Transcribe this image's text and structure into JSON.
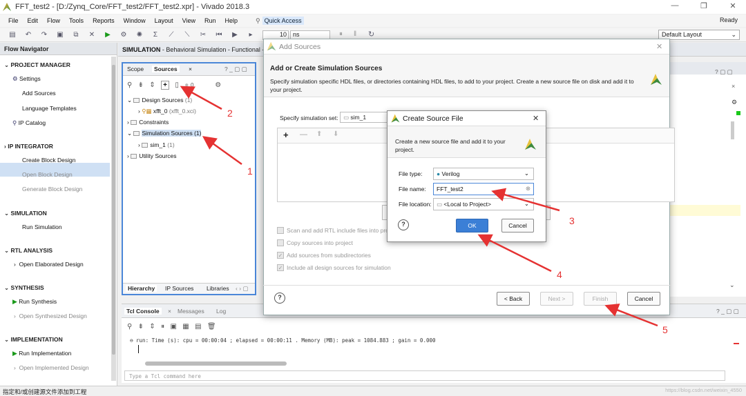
{
  "window": {
    "title": "FFT_test2 - [D:/Zynq_Core/FFT_test2/FFT_test2.xpr] - Vivado 2018.3",
    "status_ready": "Ready"
  },
  "menu": [
    "File",
    "Edit",
    "Flow",
    "Tools",
    "Reports",
    "Window",
    "Layout",
    "View",
    "Run",
    "Help"
  ],
  "quick_access": {
    "label": "Quick Access"
  },
  "toolbar": {
    "time_value": "10",
    "time_unit": "ns",
    "layout": "Default Layout"
  },
  "flow_navigator": {
    "title": "Flow Navigator",
    "sections": [
      {
        "name": "PROJECT MANAGER",
        "items": [
          "Settings",
          "Add Sources",
          "Language Templates",
          "IP Catalog"
        ]
      },
      {
        "name": "IP INTEGRATOR",
        "items": [
          "Create Block Design",
          "Open Block Design",
          "Generate Block Design"
        ]
      },
      {
        "name": "SIMULATION",
        "items": [
          "Run Simulation"
        ]
      },
      {
        "name": "RTL ANALYSIS",
        "items": [
          "Open Elaborated Design"
        ]
      },
      {
        "name": "SYNTHESIS",
        "items": [
          "Run Synthesis",
          "Open Synthesized Design"
        ]
      },
      {
        "name": "IMPLEMENTATION",
        "items": [
          "Run Implementation",
          "Open Implemented Design"
        ]
      }
    ]
  },
  "sim_header": {
    "bold": "SIMULATION",
    "rest": " - Behavioral Simulation - Functional - sim"
  },
  "sources_panel": {
    "tabs": [
      "Scope",
      "Sources"
    ],
    "counter": "0",
    "tree": {
      "design_sources": "Design Sources",
      "design_count": "(1)",
      "xfft": "xfft_0",
      "xfft_file": "(xfft_0.xci)",
      "constraints": "Constraints",
      "simulation_sources": "Simulation Sources (1)",
      "sim_1": "sim_1",
      "sim_1_count": "(1)",
      "utility": "Utility Sources"
    },
    "bottom_tabs": [
      "Hierarchy",
      "IP Sources",
      "Libraries"
    ]
  },
  "tcl": {
    "tabs": [
      "Tcl Console",
      "Messages",
      "Log"
    ],
    "output": "run: Time (s): cpu = 00:00:04 ; elapsed = 00:00:11 . Memory (MB): peak = 1084.883 ; gain = 0.000",
    "placeholder": "Type a Tcl command here"
  },
  "status_bar": "指定和/或创建源文件添加到工程",
  "watermark": "https://blog.csdn.net/weixin_4550",
  "add_sources": {
    "title": "Add Sources",
    "heading": "Add or Create Simulation Sources",
    "description": "Specify simulation specific HDL files, or directories containing HDL files, to add to your project. Create a new source file on disk and add it to your project.",
    "sim_set_label": "Specify simulation set:",
    "sim_set_value": "sim_1",
    "options": [
      {
        "label": "Scan and add RTL include files into proj",
        "checked": false
      },
      {
        "label": "Copy sources into project",
        "checked": false
      },
      {
        "label": "Add sources from subdirectories",
        "checked": true
      },
      {
        "label": "Include all design sources for simulation",
        "checked": true
      }
    ],
    "back": "< Back",
    "next": "Next >",
    "finish": "Finish",
    "cancel": "Cancel"
  },
  "create_source": {
    "title": "Create Source File",
    "description": "Create a new source file and add it to your project.",
    "file_type_label": "File type:",
    "file_type": "Verilog",
    "file_name_label": "File name:",
    "file_name": "FFT_test2",
    "file_location_label": "File location:",
    "file_location": "<Local to Project>",
    "ok": "OK",
    "cancel": "Cancel"
  },
  "annotations": [
    "1",
    "2",
    "3",
    "4",
    "5"
  ],
  "colors": {
    "accent": "#4a86d8",
    "arrow": "#e53232",
    "ok_button": "#3b7fd6"
  }
}
